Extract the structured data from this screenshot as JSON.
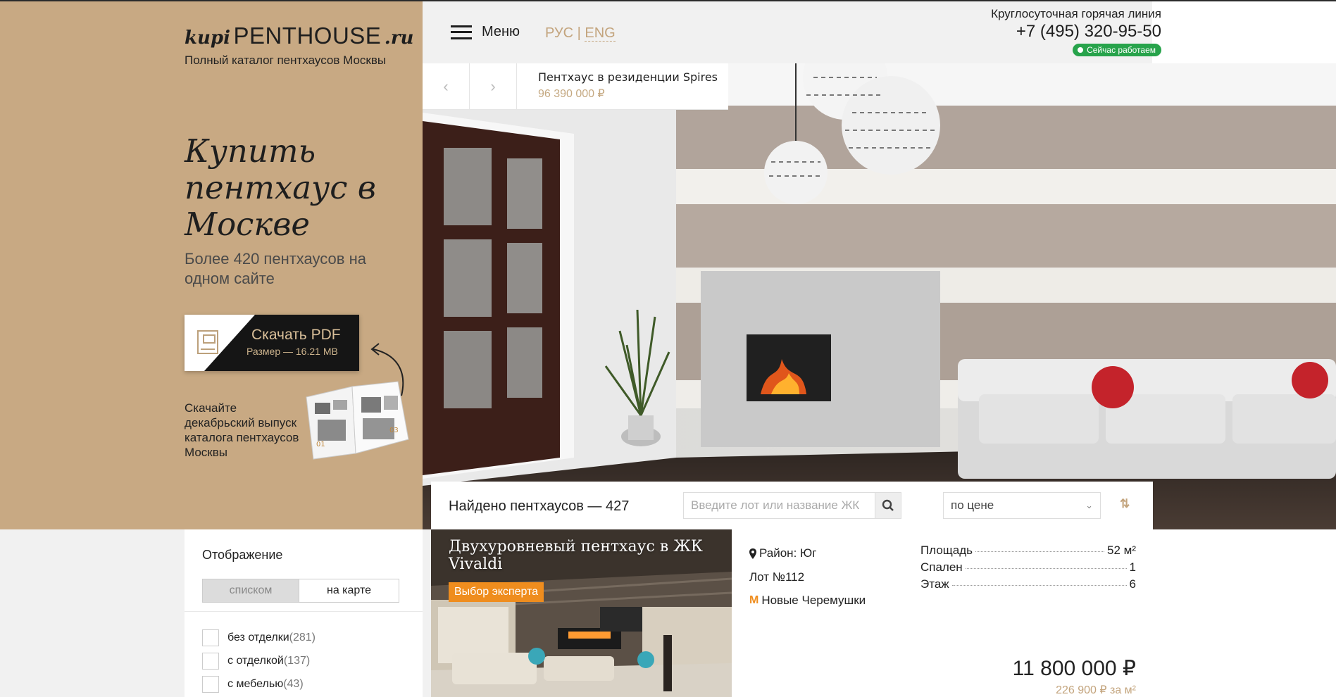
{
  "logo": {
    "kupi": "kupi",
    "main": "PENTHOUSE",
    "ru": ".ru",
    "subtitle": "Полный каталог пентхаусов Москвы"
  },
  "hero": {
    "title": "Купить пентхаус в Москве",
    "subtitle": "Более 420 пентхаусов на одном сайте"
  },
  "pdf": {
    "label": "Скачать PDF",
    "size": "Размер — 16.21 MB",
    "catalog_text": "Скачайте декабрьский выпуск каталога пентхаусов Москвы",
    "icon": "file-icon"
  },
  "header": {
    "menu_label": "Меню",
    "lang_ru": "РУС",
    "lang_sep": "|",
    "lang_en": "ENG",
    "hotline_label": "Круглосуточная горячая линия",
    "hotline_phone": "+7 (495) 320-95-50",
    "status": "Сейчас работаем"
  },
  "slider": {
    "prev": "‹",
    "next": "›",
    "title": "Пентхаус в резиденции Spires",
    "price": "96 390 000 ₽"
  },
  "search": {
    "found": "Найдено пентхаусов — 427",
    "placeholder": "Введите лот или название ЖК",
    "sort_value": "по цене",
    "sort_toggle": "⇅"
  },
  "display": {
    "title": "Отображение",
    "list_label": "списком",
    "map_label": "на карте",
    "filters": [
      {
        "label": "без отделки",
        "count": "(281)"
      },
      {
        "label": "с отделкой",
        "count": "(137)"
      },
      {
        "label": "с мебелью",
        "count": "(43)"
      }
    ]
  },
  "listing": {
    "title": "Двухуровневый пентхаус в ЖК Vivaldi",
    "badge": "Выбор эксперта",
    "district": "Район: Юг",
    "lot": "Лот №112",
    "metro": "Новые Черемушки",
    "specs": [
      {
        "label": "Площадь",
        "value": "52 м²"
      },
      {
        "label": "Спален",
        "value": "1"
      },
      {
        "label": "Этаж",
        "value": "6"
      }
    ],
    "price": "11 800 000 ₽",
    "price_per_m2": "226 900 ₽ за м²"
  },
  "colors": {
    "sidebar": "#c8a983",
    "accent": "#c3a47d",
    "status": "#27a34b",
    "badge": "#ef8d1e"
  }
}
